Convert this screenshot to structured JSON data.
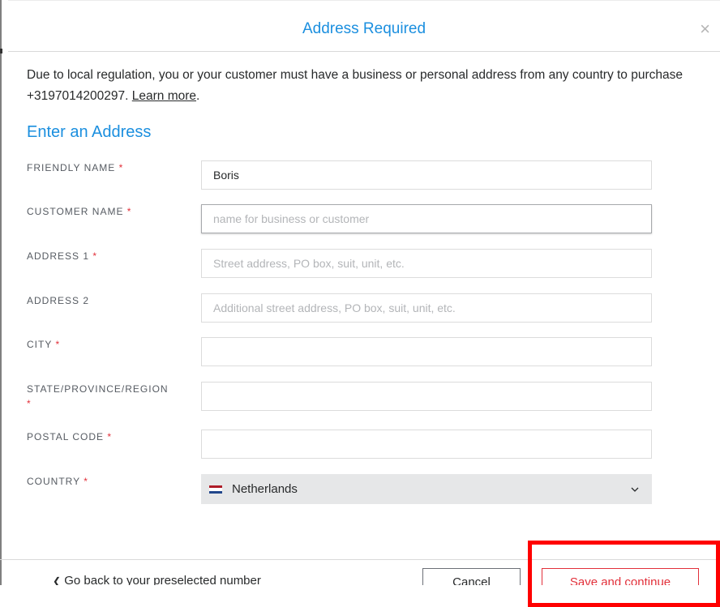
{
  "dialog": {
    "title": "Address Required",
    "close_symbol": "×",
    "intro_text": "Due to local regulation, you or your customer must have a business or personal address from any country to purchase +3197014200297.",
    "learn_more": "Learn more",
    "intro_end": ".",
    "section_title": "Enter an Address"
  },
  "form": {
    "required_marker": "*",
    "fields": [
      {
        "label": "FRIENDLY NAME",
        "required": "*",
        "value": "Boris",
        "placeholder": ""
      },
      {
        "label": "CUSTOMER NAME",
        "required": "*",
        "value": "",
        "placeholder": "name for business or customer"
      },
      {
        "label": "ADDRESS 1",
        "required": "*",
        "value": "",
        "placeholder": "Street address, PO box, suit, unit, etc."
      },
      {
        "label": "ADDRESS 2",
        "required": "",
        "value": "",
        "placeholder": "Additional street address, PO box, suit, unit, etc."
      },
      {
        "label": "CITY",
        "required": "*",
        "value": "",
        "placeholder": ""
      },
      {
        "label": "STATE/PROVINCE/REGION",
        "required": "*",
        "value": "",
        "placeholder": ""
      },
      {
        "label": "POSTAL CODE",
        "required": "*",
        "value": "",
        "placeholder": ""
      }
    ],
    "country": {
      "label": "COUNTRY",
      "required": "*",
      "value": "Netherlands",
      "flag_icon": "netherlands-flag-icon"
    }
  },
  "footer": {
    "back_chevron": "❮",
    "back_label": "Go back to your preselected number",
    "cancel_label": "Cancel",
    "save_label": "Save and continue"
  },
  "colors": {
    "accent_blue": "#1b8fdf",
    "required_red": "#e2303a",
    "highlight_red": "#ff0000"
  }
}
